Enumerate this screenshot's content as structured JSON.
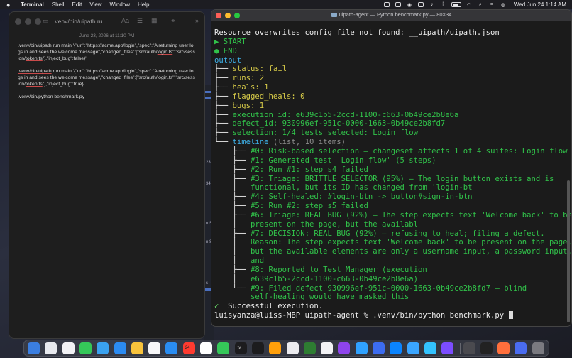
{
  "menubar": {
    "app": "Terminal",
    "items": [
      "Shell",
      "Edit",
      "View",
      "Window",
      "Help"
    ],
    "clock": "Wed Jun 24  1:14 AM"
  },
  "notes": {
    "title": ".venv/bin/uipath ru...",
    "date": "June 23, 2026 at 11:10 PM",
    "para1": [
      ".venv/bin/uipath",
      " run main '{\"url\":\"https://acme.app/login\",\"spec\":\"A returning user logs in and sees the welcome message\",\"changed_files\":[\"src/auth/",
      "login.ts",
      "\",\"src/session/",
      "token.ts",
      "\"],\"inject_bug\":false}'"
    ],
    "para2": [
      ".venv/bin/uipath",
      " run main '{\"url\":\"https://acme.app/login\",\"spec\":\"A returning user logs in and sees the welcome message\",\"changed_files\":[\"src/auth/",
      "login.ts",
      "\",\"src/session/",
      "token.ts",
      "\"],\"inject_bug\":true}'"
    ],
    "para3": ".venv/bin/python benchmark.py"
  },
  "terminal": {
    "title": "uipath-agent — Python benchmark.py — 80×34",
    "lines": [
      [
        {
          "t": "Resource overwrites config file not found: __uipath/uipath.json",
          "c": "white"
        }
      ],
      [
        {
          "t": "▶ START",
          "c": "green"
        }
      ],
      [
        {
          "t": "● END",
          "c": "green"
        }
      ],
      [
        {
          "t": "output",
          "c": "cyan"
        }
      ],
      [
        {
          "t": "├── ",
          "c": "white"
        },
        {
          "t": "status: fail",
          "c": "yellow"
        }
      ],
      [
        {
          "t": "├── ",
          "c": "white"
        },
        {
          "t": "runs: 2",
          "c": "yellow"
        }
      ],
      [
        {
          "t": "├── ",
          "c": "white"
        },
        {
          "t": "heals: 1",
          "c": "yellow"
        }
      ],
      [
        {
          "t": "├── ",
          "c": "white"
        },
        {
          "t": "flagged_heals: 0",
          "c": "yellow"
        }
      ],
      [
        {
          "t": "├── ",
          "c": "white"
        },
        {
          "t": "bugs: 1",
          "c": "yellow"
        }
      ],
      [
        {
          "t": "├── ",
          "c": "white"
        },
        {
          "t": "execution_id: e639c1b5-2ccd-1100-c663-0b49ce2b8e6a",
          "c": "green"
        }
      ],
      [
        {
          "t": "├── ",
          "c": "white"
        },
        {
          "t": "defect_id: 930996ef-951c-0000-1663-0b49ce2b8fd7",
          "c": "green"
        }
      ],
      [
        {
          "t": "├── ",
          "c": "white"
        },
        {
          "t": "selection: 1/4 tests selected: Login flow",
          "c": "green"
        }
      ],
      [
        {
          "t": "└── ",
          "c": "white"
        },
        {
          "t": "timeline",
          "c": "cyan"
        },
        {
          "t": " (list, 10 items)",
          "c": "gray"
        }
      ],
      [
        {
          "t": "    ├── ",
          "c": "white"
        },
        {
          "t": "#0: Risk-based selection — changeset affects 1 of 4 suites: Login flow",
          "c": "green"
        }
      ],
      [
        {
          "t": "    ├── ",
          "c": "white"
        },
        {
          "t": "#1: Generated test 'Login flow' (5 steps)",
          "c": "green"
        }
      ],
      [
        {
          "t": "    ├── ",
          "c": "white"
        },
        {
          "t": "#2: Run #1: step s4 failed",
          "c": "green"
        }
      ],
      [
        {
          "t": "    ├── ",
          "c": "white"
        },
        {
          "t": "#3: Triage: BRITTLE_SELECTOR (95%) — The login button exists and is",
          "c": "green"
        }
      ],
      [
        {
          "t": "    │   ",
          "c": "white"
        },
        {
          "t": "functional, but its ID has changed from 'login-bt",
          "c": "green"
        }
      ],
      [
        {
          "t": "    ├── ",
          "c": "white"
        },
        {
          "t": "#4: Self-healed: #login-btn -> button#sign-in-btn",
          "c": "green"
        }
      ],
      [
        {
          "t": "    ├── ",
          "c": "white"
        },
        {
          "t": "#5: Run #2: step s5 failed",
          "c": "green"
        }
      ],
      [
        {
          "t": "    ├── ",
          "c": "white"
        },
        {
          "t": "#6: Triage: REAL_BUG (92%) — The step expects text 'Welcome back' to be",
          "c": "green"
        }
      ],
      [
        {
          "t": "    │   ",
          "c": "white"
        },
        {
          "t": "present on the page, but the availabl",
          "c": "green"
        }
      ],
      [
        {
          "t": "    ├── ",
          "c": "white"
        },
        {
          "t": "#7: DECISION: REAL BUG (92%) — refusing to heal; filing a defect.",
          "c": "green"
        }
      ],
      [
        {
          "t": "    │   ",
          "c": "white"
        },
        {
          "t": "Reason: The step expects text 'Welcome back' to be present on the page,",
          "c": "green"
        }
      ],
      [
        {
          "t": "    │   ",
          "c": "white"
        },
        {
          "t": "but the available elements are only a username input, a password input,",
          "c": "green"
        }
      ],
      [
        {
          "t": "    │   ",
          "c": "white"
        },
        {
          "t": "and",
          "c": "green"
        }
      ],
      [
        {
          "t": "    ├── ",
          "c": "white"
        },
        {
          "t": "#8: Reported to Test Manager (execution",
          "c": "green"
        }
      ],
      [
        {
          "t": "    │   ",
          "c": "white"
        },
        {
          "t": "e639c1b5-2ccd-1100-c663-0b49ce2b8e6a)",
          "c": "green"
        }
      ],
      [
        {
          "t": "    └── ",
          "c": "white"
        },
        {
          "t": "#9: Filed defect 930996ef-951c-0000-1663-0b49ce2b8fd7 — blind",
          "c": "green"
        }
      ],
      [
        {
          "t": "        ",
          "c": "white"
        },
        {
          "t": "self-healing would have masked this",
          "c": "green"
        }
      ],
      [
        {
          "t": "✓ ",
          "c": "bgreen"
        },
        {
          "t": " Successful execution.",
          "c": "white"
        }
      ],
      [
        {
          "t": "luisyanza@luiss-MBP uipath-agent % .venv/bin/python benchmark.py",
          "c": "white"
        }
      ]
    ]
  },
  "bg_window_labels": [
    "23",
    "34",
    "n S",
    "n S",
    "s"
  ],
  "dock": {
    "colors": [
      "#3b7ee0",
      "#e8eaef",
      "#f2f2f5",
      "#35c759",
      "#3aa2f0",
      "#2b8bf2",
      "#f8c33c",
      "#f7f7f9",
      "#2a8df2",
      "#ff3b30",
      "#ffffff",
      "#35c759",
      "#1c1c1e",
      "#1c1c1e",
      "#ff9f0a",
      "#ececf0",
      "#2e7d32",
      "#f2f2f5",
      "#8e44ec",
      "#30a2ff",
      "#3c6cf0",
      "#0b84ff",
      "#3aa5ff",
      "#33c3ff",
      "#7c4dff",
      "#4a4a4f",
      "#222",
      "#ff6f3c",
      "#4a6cf0",
      "#7a7a80"
    ],
    "date_label": "24",
    "tv_label": "tv"
  }
}
